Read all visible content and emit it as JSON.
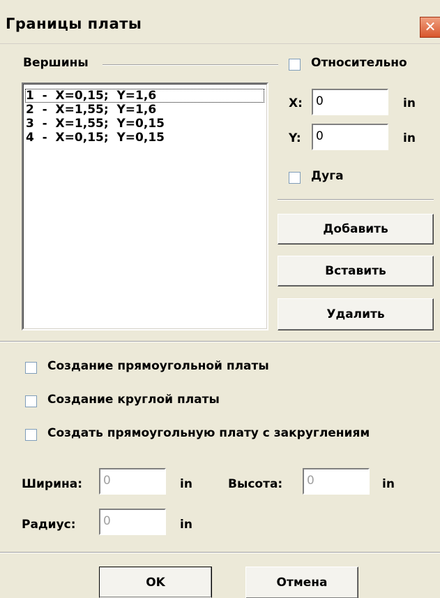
{
  "window": {
    "title": "Границы платы"
  },
  "vertices": {
    "group_label": "Вершины",
    "relative_label": "Относительно",
    "items": [
      "1  -  X=0,15;  Y=1,6",
      "2  -  X=1,55;  Y=1,6",
      "3  -  X=1,55;  Y=0,15",
      "4  -  X=0,15;  Y=0,15"
    ],
    "x_label": "X:",
    "x_value": "0",
    "x_unit": "in",
    "y_label": "Y:",
    "y_value": "0",
    "y_unit": "in",
    "arc_label": "Дуга",
    "add_label": "Добавить",
    "insert_label": "Вставить",
    "delete_label": "Удалить"
  },
  "options": {
    "rect_label": "Создание прямоугольной платы",
    "round_label": "Создание круглой платы",
    "rounded_rect_label": "Создать прямоугольную плату с закруглениям",
    "width_label": "Ширина:",
    "width_value": "0",
    "width_unit": "in",
    "height_label": "Высота:",
    "height_value": "0",
    "height_unit": "in",
    "radius_label": "Радиус:",
    "radius_value": "0",
    "radius_unit": "in"
  },
  "footer": {
    "ok_label": "OK",
    "cancel_label": "Отмена"
  },
  "icons": {
    "close": "close-icon"
  },
  "colors": {
    "dialog_bg": "#ece9d8",
    "close_button": "#d8562c",
    "checkbox_border": "#7f9db9",
    "disabled_text": "#a0a0a0"
  }
}
